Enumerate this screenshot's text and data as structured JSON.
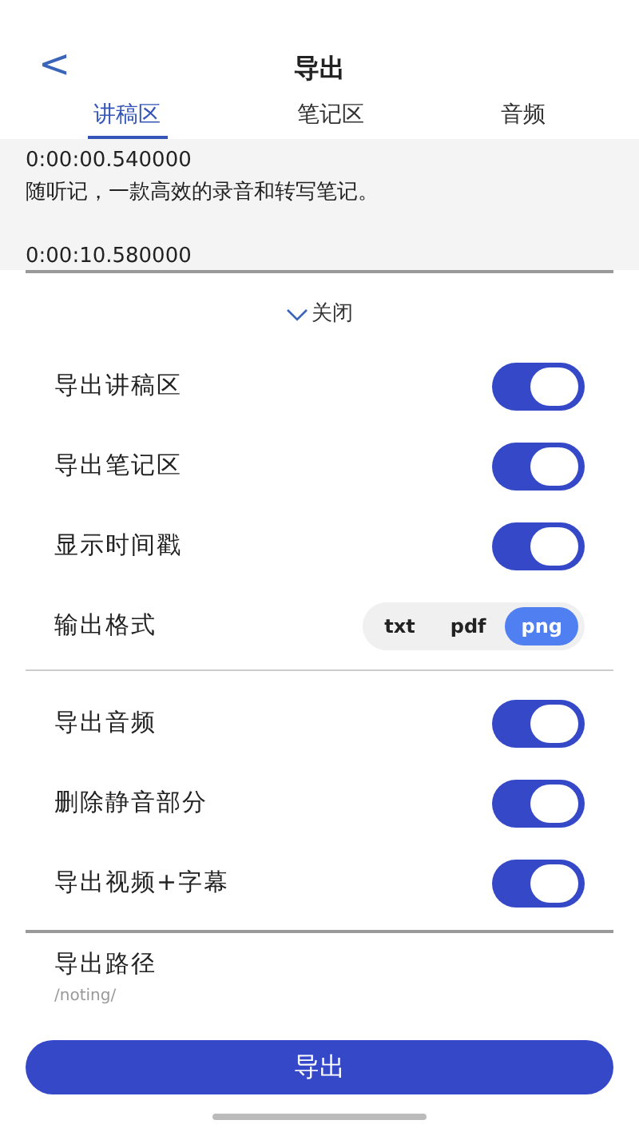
{
  "header": {
    "back": "<",
    "title": "导出"
  },
  "tabs": [
    {
      "label": "讲稿区",
      "selected": true
    },
    {
      "label": "笔记区",
      "selected": false
    },
    {
      "label": "音频",
      "selected": false
    }
  ],
  "preview": {
    "entries": [
      {
        "time": "0:00:00.540000",
        "text": "随听记，一款高效的录音和转写笔记。"
      },
      {
        "time": "0:00:10.580000"
      }
    ]
  },
  "collapse": {
    "label": "关闭",
    "expanded": true
  },
  "groups": [
    {
      "rows": [
        {
          "kind": "toggle",
          "label": "导出讲稿区",
          "on": true
        },
        {
          "kind": "toggle",
          "label": "导出笔记区",
          "on": true
        },
        {
          "kind": "toggle",
          "label": "显示时间戳",
          "on": true
        },
        {
          "kind": "format",
          "label": "输出格式",
          "options": [
            {
              "label": "txt",
              "selected": false
            },
            {
              "label": "pdf",
              "selected": false
            },
            {
              "label": "png",
              "selected": true
            }
          ]
        }
      ]
    },
    {
      "rows": [
        {
          "kind": "toggle",
          "label": "导出音频",
          "on": true
        },
        {
          "kind": "toggle",
          "label": "删除静音部分",
          "on": true
        },
        {
          "kind": "toggle",
          "label": "导出视频+字幕",
          "on": true
        }
      ]
    }
  ],
  "path": {
    "label": "导出路径",
    "value": "/noting/"
  },
  "export_button": "导出"
}
